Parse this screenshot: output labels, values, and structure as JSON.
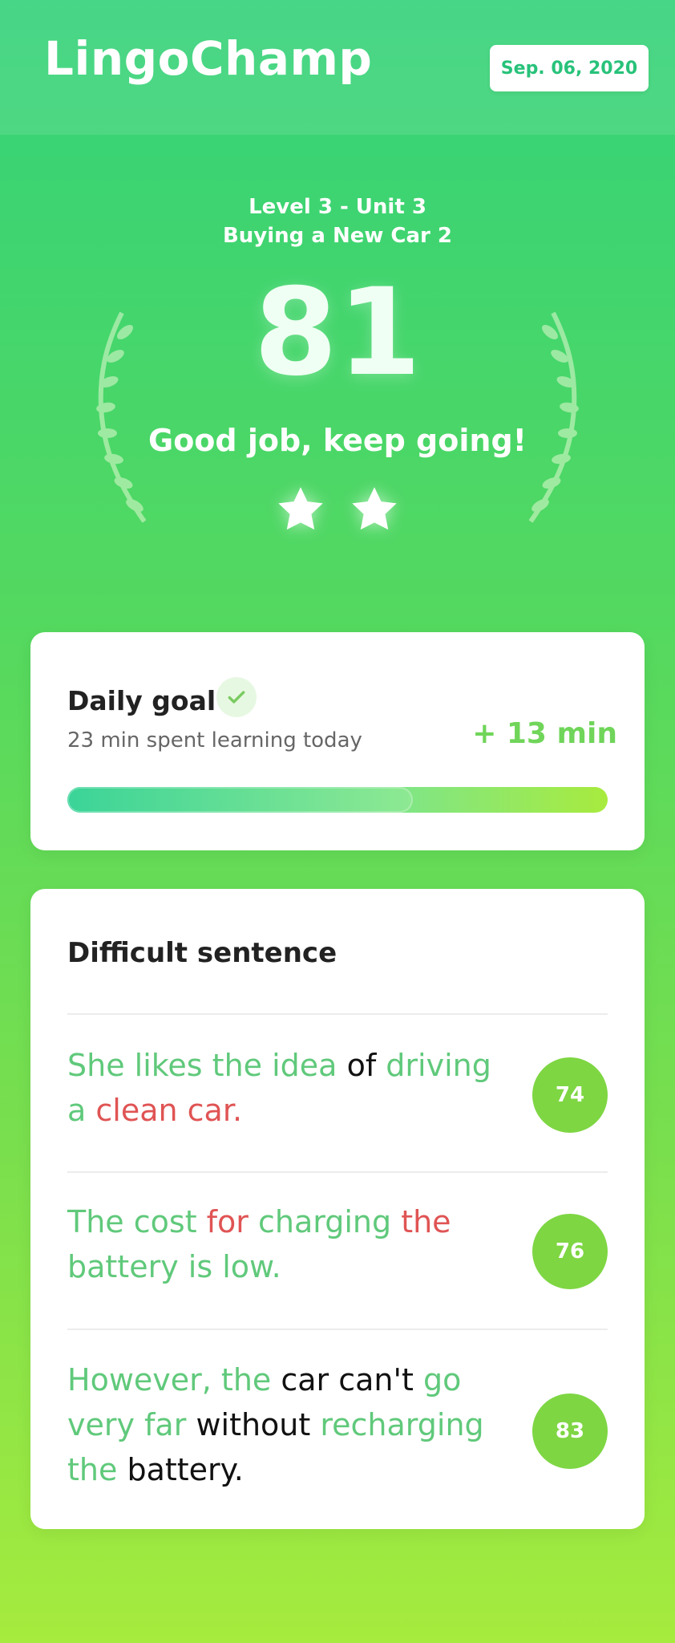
{
  "app": {
    "brand": "LingoChamp",
    "date": "Sep. 06, 2020"
  },
  "hero": {
    "level_line": "Level 3 - Unit 3",
    "lesson_title": "Buying a New Car 2",
    "score": "81",
    "praise": "Good job, keep going!",
    "stars": 2,
    "icons": {
      "left_laurel": "laurel-icon",
      "right_laurel": "laurel-icon",
      "star": "star-icon"
    }
  },
  "daily_goal": {
    "title": "Daily goal",
    "completed": true,
    "check_icon": "check-icon",
    "subtitle": "23 min spent learning today",
    "extra": "+ 13 min",
    "progress": 0.64
  },
  "difficult": {
    "title": "Difficult sentence",
    "items": [
      {
        "score": "74",
        "segments": [
          {
            "t": "She likes the idea",
            "c": "green"
          },
          {
            "t": " of ",
            "c": "black"
          },
          {
            "t": "driving",
            "c": "green"
          },
          {
            "t": " a ",
            "c": "green"
          },
          {
            "t": "clean car.",
            "c": "red"
          }
        ]
      },
      {
        "score": "76",
        "segments": [
          {
            "t": "The cost ",
            "c": "green"
          },
          {
            "t": "for",
            "c": "red"
          },
          {
            "t": " charging ",
            "c": "green"
          },
          {
            "t": "the",
            "c": "red"
          },
          {
            "t": " battery is low.",
            "c": "green"
          }
        ]
      },
      {
        "score": "83",
        "segments": [
          {
            "t": "However, the",
            "c": "green"
          },
          {
            "t": " car can't ",
            "c": "black"
          },
          {
            "t": "go very far",
            "c": "green"
          },
          {
            "t": " without ",
            "c": "black"
          },
          {
            "t": "recharging",
            "c": "green"
          },
          {
            "t": " the",
            "c": "green"
          },
          {
            "t": " battery.",
            "c": "black"
          }
        ]
      }
    ]
  },
  "colors": {
    "accent_green": "#60C97B",
    "error_red": "#E05454",
    "badge_green": "#7ED643",
    "date_text": "#28C27A"
  }
}
